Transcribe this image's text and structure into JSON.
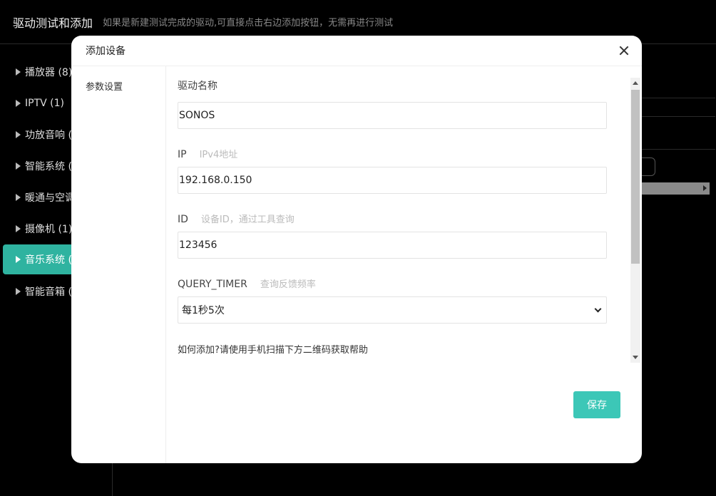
{
  "topbar": {
    "title": "驱动测试和添加",
    "hint": "如果是新建测试完成的驱动,可直接点击右边添加按钮，无需再进行测试"
  },
  "sidebar": {
    "items": [
      {
        "label": "播放器 (8)"
      },
      {
        "label": "IPTV (1)"
      },
      {
        "label": "功放音响 ("
      },
      {
        "label": "智能系统 ("
      },
      {
        "label": "暖通与空调"
      },
      {
        "label": "摄像机 (1)"
      },
      {
        "label": "音乐系统 ("
      },
      {
        "label": "智能音箱 ("
      }
    ],
    "active_index": 6
  },
  "modal": {
    "title": "添加设备",
    "nav": {
      "item": "参数设置"
    },
    "fields": {
      "driver_name": {
        "label": "驱动名称",
        "value": "SONOS"
      },
      "ip": {
        "label": "IP",
        "sub": "IPv4地址",
        "value": "192.168.0.150"
      },
      "id": {
        "label": "ID",
        "sub": "设备ID，通过工具查询",
        "value": "123456"
      },
      "query_timer": {
        "label": "QUERY_TIMER",
        "sub": "查询反馈频率",
        "value": "每1秒5次"
      }
    },
    "help": "如何添加?请使用手机扫描下方二维码获取帮助",
    "save_label": "保存"
  },
  "colors": {
    "accent": "#3cc7b7",
    "sidebar_active": "#2fb3a0",
    "background": "#000000"
  }
}
